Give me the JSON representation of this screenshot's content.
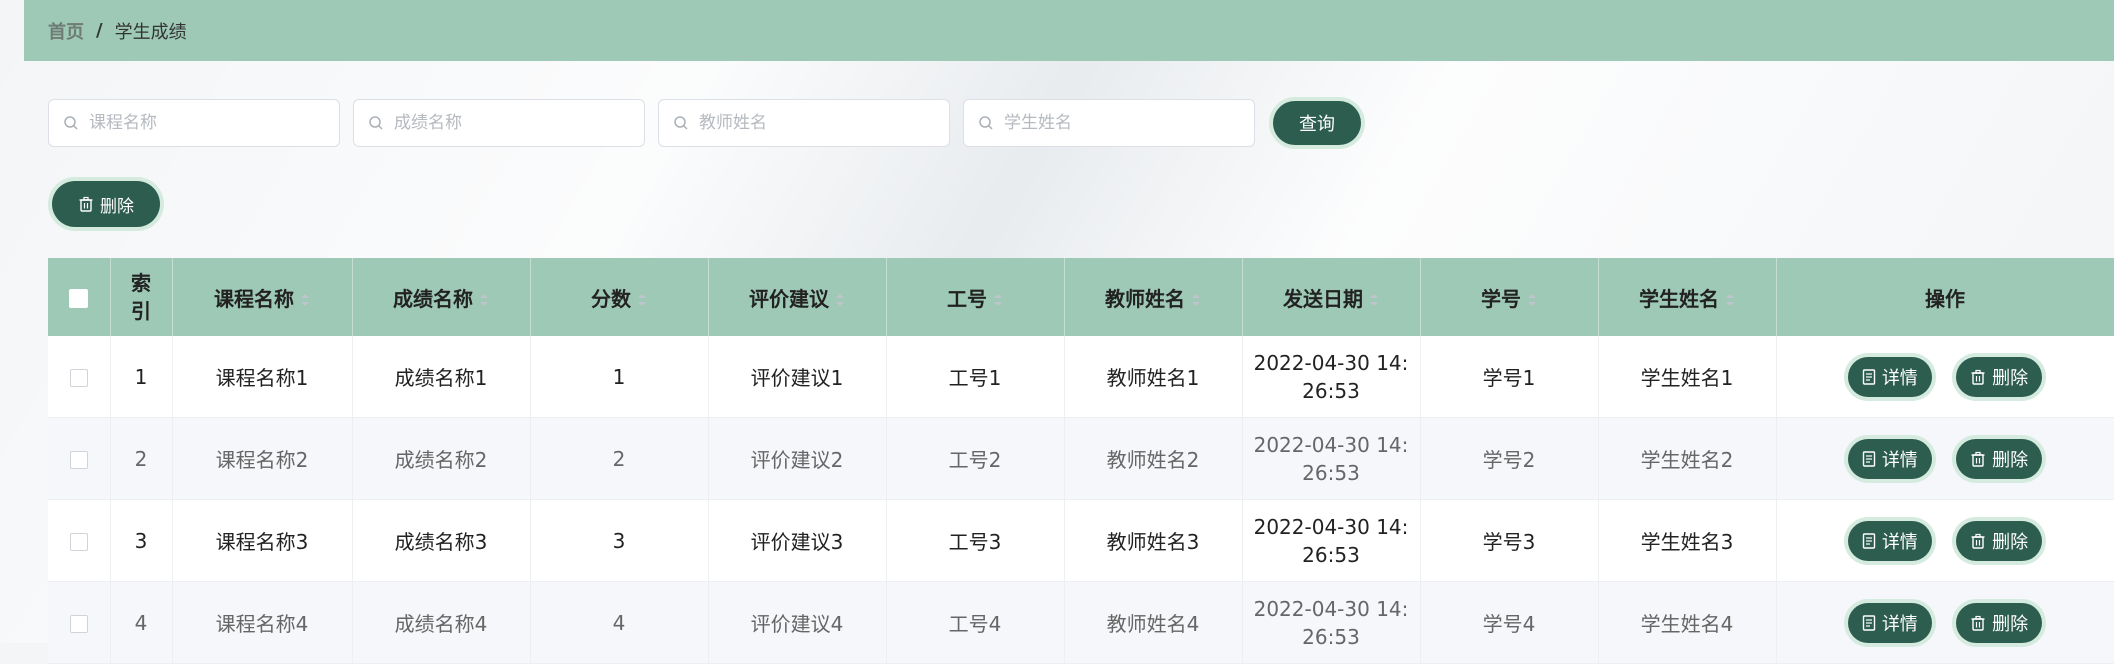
{
  "breadcrumb": {
    "home": "首页",
    "separator": "/",
    "current": "学生成绩"
  },
  "search": {
    "course_placeholder": "课程名称",
    "score_name_placeholder": "成绩名称",
    "teacher_placeholder": "教师姓名",
    "student_placeholder": "学生姓名",
    "query_label": "查询"
  },
  "toolbar": {
    "delete_label": "删除"
  },
  "table": {
    "headers": {
      "index": "索引",
      "course": "课程名称",
      "score_name": "成绩名称",
      "score": "分数",
      "advice": "评价建议",
      "job_no": "工号",
      "teacher": "教师姓名",
      "date": "发送日期",
      "student_no": "学号",
      "student": "学生姓名",
      "ops": "操作"
    },
    "rows": [
      {
        "index": "1",
        "course": "课程名称1",
        "score_name": "成绩名称1",
        "score": "1",
        "advice": "评价建议1",
        "job_no": "工号1",
        "teacher": "教师姓名1",
        "date_a": "2022-04-30 14:",
        "date_b": "26:53",
        "student_no": "学号1",
        "student": "学生姓名1"
      },
      {
        "index": "2",
        "course": "课程名称2",
        "score_name": "成绩名称2",
        "score": "2",
        "advice": "评价建议2",
        "job_no": "工号2",
        "teacher": "教师姓名2",
        "date_a": "2022-04-30 14:",
        "date_b": "26:53",
        "student_no": "学号2",
        "student": "学生姓名2"
      },
      {
        "index": "3",
        "course": "课程名称3",
        "score_name": "成绩名称3",
        "score": "3",
        "advice": "评价建议3",
        "job_no": "工号3",
        "teacher": "教师姓名3",
        "date_a": "2022-04-30 14:",
        "date_b": "26:53",
        "student_no": "学号3",
        "student": "学生姓名3"
      },
      {
        "index": "4",
        "course": "课程名称4",
        "score_name": "成绩名称4",
        "score": "4",
        "advice": "评价建议4",
        "job_no": "工号4",
        "teacher": "教师姓名4",
        "date_a": "2022-04-30 14:",
        "date_b": "26:53",
        "student_no": "学号4",
        "student": "学生姓名4"
      }
    ],
    "detail_label": "详情",
    "delete_label": "删除"
  },
  "colors": {
    "header_bg": "#9ec9b7",
    "button_bg": "#2d5d4e"
  }
}
